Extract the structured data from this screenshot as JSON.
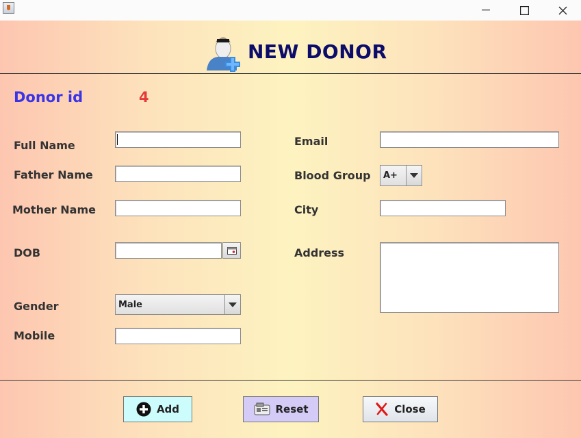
{
  "window": {
    "minimize_glyph": "—",
    "maximize_glyph": "☐",
    "close_glyph": "✕"
  },
  "header": {
    "title": "NEW DONOR",
    "icon": "donor-add-icon"
  },
  "donor_id": {
    "label": "Donor id",
    "value": "4"
  },
  "form": {
    "full_name": {
      "label": "Full Name",
      "value": ""
    },
    "father_name": {
      "label": "Father Name",
      "value": ""
    },
    "mother_name": {
      "label": "Mother Name",
      "value": ""
    },
    "dob": {
      "label": "DOB",
      "value": ""
    },
    "gender": {
      "label": "Gender",
      "value": "Male"
    },
    "mobile": {
      "label": "Mobile",
      "value": ""
    },
    "email": {
      "label": "Email",
      "value": ""
    },
    "blood_group": {
      "label": "Blood Group",
      "value": "A+"
    },
    "city": {
      "label": "City",
      "value": ""
    },
    "address": {
      "label": "Address",
      "value": ""
    }
  },
  "buttons": {
    "add": {
      "label": "Add",
      "color": "#cdfcfc"
    },
    "reset": {
      "label": "Reset",
      "color": "#d4ccf7"
    },
    "close": {
      "label": "Close",
      "color": "#e9edf2"
    }
  },
  "colors": {
    "title": "#0c0c6b",
    "donor_id_label": "#3b34e6",
    "donor_id_value": "#e63a3a"
  }
}
